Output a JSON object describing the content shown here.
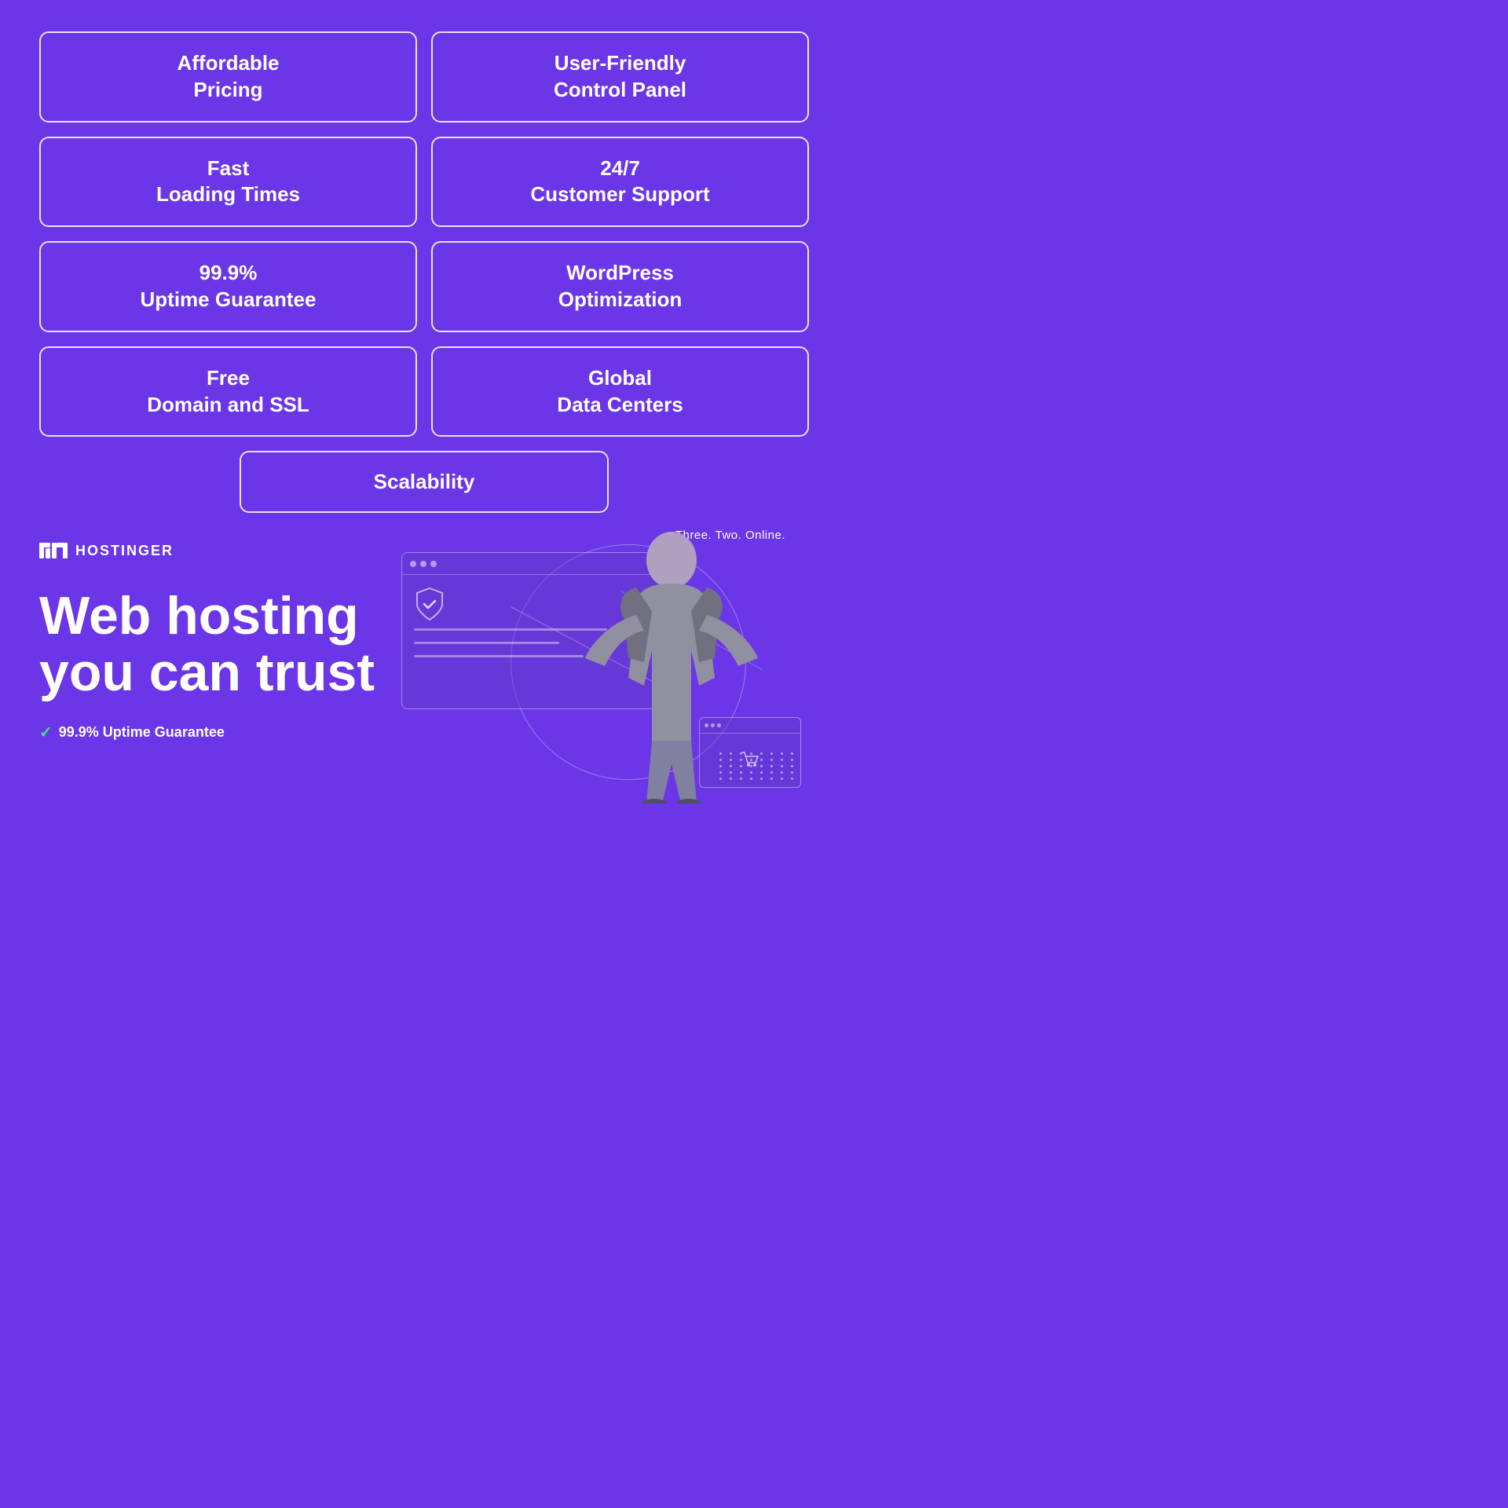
{
  "background_color": "#6b35e8",
  "features": [
    {
      "id": "affordable-pricing",
      "label": "Affordable\nPricing"
    },
    {
      "id": "user-friendly",
      "label": "User-Friendly\nControl Panel"
    },
    {
      "id": "fast-loading",
      "label": "Fast\nLoading Times"
    },
    {
      "id": "customer-support",
      "label": "24/7\nCustomer Support"
    },
    {
      "id": "uptime",
      "label": "99.9%\nUptime Guarantee"
    },
    {
      "id": "wordpress",
      "label": "WordPress\nOptimization"
    },
    {
      "id": "free-domain",
      "label": "Free\nDomain and SSL"
    },
    {
      "id": "data-centers",
      "label": "Global\nData Centers"
    }
  ],
  "scalability": {
    "label": "Scalability"
  },
  "logo": {
    "text": "HOSTINGER"
  },
  "tagline": {
    "line1": "Web hosting",
    "line2": "you can trust"
  },
  "uptime_badge": {
    "text": "99.9% Uptime Guarantee"
  },
  "branding": {
    "tagline": "Three. Two. Online."
  }
}
